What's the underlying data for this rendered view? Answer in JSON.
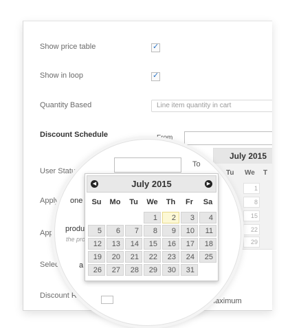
{
  "form": {
    "show_price_table": "Show price table",
    "show_in_loop": "Show in loop",
    "quantity_based": "Quantity Based",
    "quantity_based_value": "Line item quantity in cart",
    "discount_schedule": "Discount Schedule",
    "from_label": "From",
    "to_label": "To",
    "user_status": "User Status",
    "apply_to": "Apply to",
    "apply_ad": "Apply ad",
    "select_prod": "Select Prod",
    "discount_rules": "Discount Rules",
    "maximum": "Maximum",
    "partial_one": "one",
    "partial_produ": "produ",
    "partial_the_pro": "the pro",
    "partial_a": "a",
    "check_mark": "✓"
  },
  "background_calendar": {
    "title": "July 2015",
    "day_names": [
      "Tu",
      "We",
      "T"
    ],
    "days": [
      "1",
      "8",
      "15",
      "22",
      "29"
    ]
  },
  "calendar": {
    "title": "July 2015",
    "day_names": [
      "Su",
      "Mo",
      "Tu",
      "We",
      "Th",
      "Fr",
      "Sa"
    ],
    "weeks": [
      [
        "",
        "",
        "",
        "1",
        "2",
        "3",
        "4"
      ],
      [
        "5",
        "6",
        "7",
        "8",
        "9",
        "10",
        "11"
      ],
      [
        "12",
        "13",
        "14",
        "15",
        "16",
        "17",
        "18"
      ],
      [
        "19",
        "20",
        "21",
        "22",
        "23",
        "24",
        "25"
      ],
      [
        "26",
        "27",
        "28",
        "29",
        "30",
        "31",
        ""
      ]
    ],
    "highlighted_day": "2",
    "prev_icon": "◀",
    "next_icon": "▶"
  }
}
